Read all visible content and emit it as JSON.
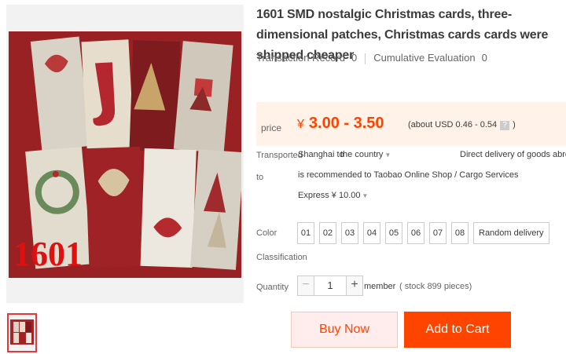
{
  "product": {
    "title": "1601 SMD nostalgic Christmas cards, three-dimensional patches, Christmas cards cards were shipped cheaper",
    "image_number": "1601"
  },
  "stats": {
    "transaction_label": "Transaction Record",
    "transaction_count": "0",
    "evaluation_label": "Cumulative Evaluation",
    "evaluation_count": "0"
  },
  "price": {
    "label": "price",
    "currency": "¥",
    "range": "3.00 - 3.50",
    "usd_prefix": "(about USD 0.46 - 0.54",
    "usd_help": "?",
    "usd_suffix": ")"
  },
  "shipping": {
    "label_line1": "Transported",
    "label_line2": "to",
    "from": "Shanghai to",
    "destination": "the country",
    "direct": "Direct delivery of goods abroad, it",
    "recommend": "is recommended to Taobao Online Shop / Cargo Services",
    "express": "Express ¥ 10.00"
  },
  "color": {
    "label": "Color",
    "label2": "Classification",
    "options": [
      "01",
      "02",
      "03",
      "04",
      "05",
      "06",
      "07",
      "08",
      "Random delivery"
    ]
  },
  "quantity": {
    "label": "Quantity",
    "value": "1",
    "minus": "−",
    "plus": "+",
    "unit": "member",
    "stock": "( stock 899 pieces)"
  },
  "actions": {
    "buy": "Buy Now",
    "cart": "Add to Cart"
  },
  "colors": {
    "accent": "#ff4400",
    "price_bg": "#fff2e8"
  }
}
